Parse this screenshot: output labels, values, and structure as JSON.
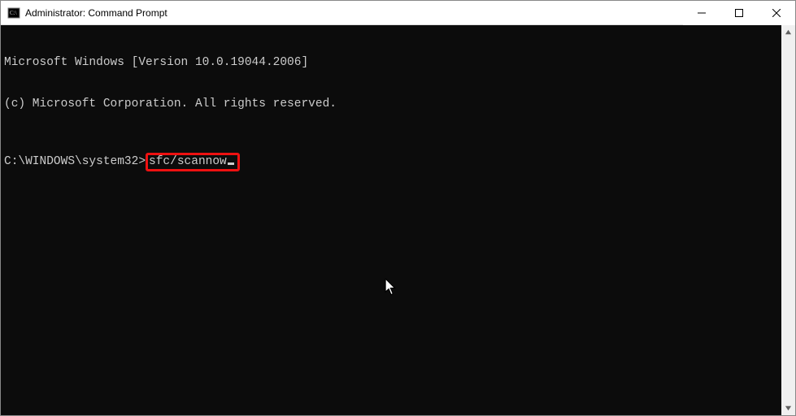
{
  "window": {
    "title": "Administrator: Command Prompt"
  },
  "terminal": {
    "line1": "Microsoft Windows [Version 10.0.19044.2006]",
    "line2": "(c) Microsoft Corporation. All rights reserved.",
    "prompt": "C:\\WINDOWS\\system32>",
    "command": "sfc/scannow"
  }
}
